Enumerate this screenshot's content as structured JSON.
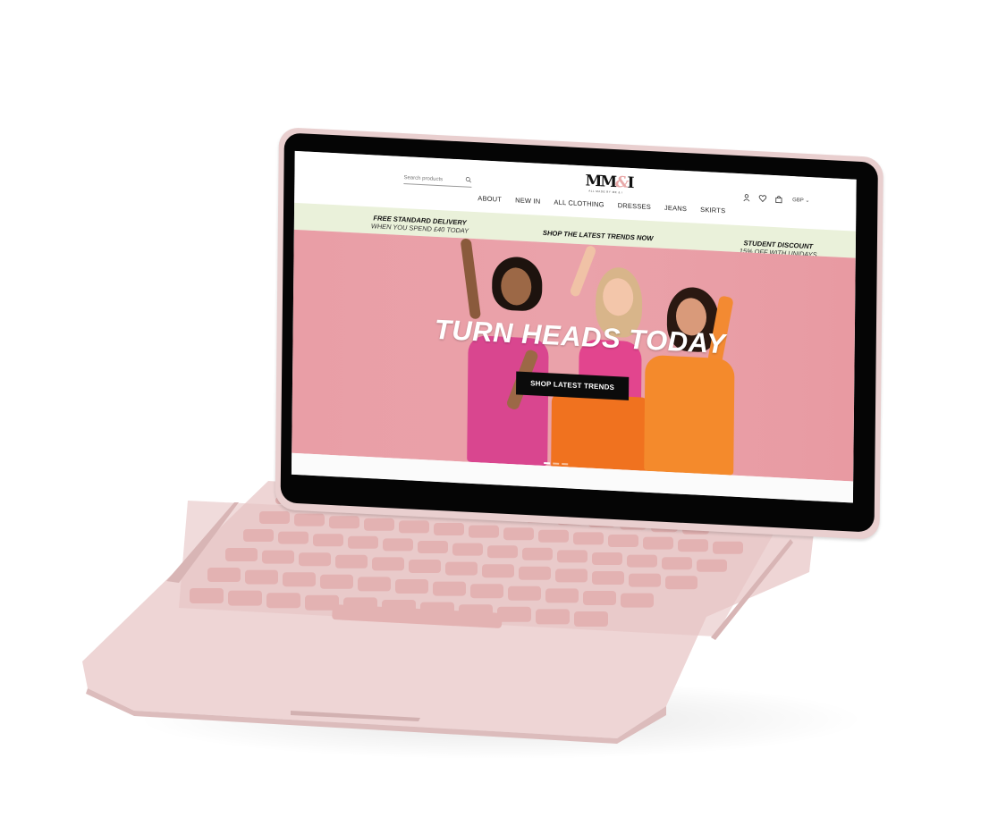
{
  "search": {
    "placeholder": "Search products"
  },
  "brand": {
    "logo_text": "MM",
    "logo_amp": "&",
    "logo_letter": "I",
    "tagline": "ALL MADE BY ME & I"
  },
  "header": {
    "currency": "GBP"
  },
  "nav": {
    "items": [
      "ABOUT",
      "NEW IN",
      "ALL CLOTHING",
      "DRESSES",
      "JEANS",
      "SKIRTS"
    ]
  },
  "promo": {
    "delivery_title": "FREE STANDARD DELIVERY",
    "delivery_sub": "WHEN YOU SPEND £40 TODAY",
    "center": "SHOP THE LATEST TRENDS NOW",
    "student_title": "STUDENT DISCOUNT",
    "student_sub": "15% OFF WITH UNIDAYS"
  },
  "hero": {
    "title": "TURN HEADS TODAY",
    "button": "SHOP LATEST TRENDS",
    "slides": 3,
    "active_slide": 1
  },
  "colors": {
    "promo_bg": "#eaf1da",
    "hero_bg": "#e99ea6",
    "button_bg": "#0b0b0b",
    "laptop_shell": "#ecd3d3"
  },
  "icons": [
    "search-icon",
    "user-icon",
    "heart-icon",
    "bag-icon",
    "chevron-down-icon"
  ]
}
